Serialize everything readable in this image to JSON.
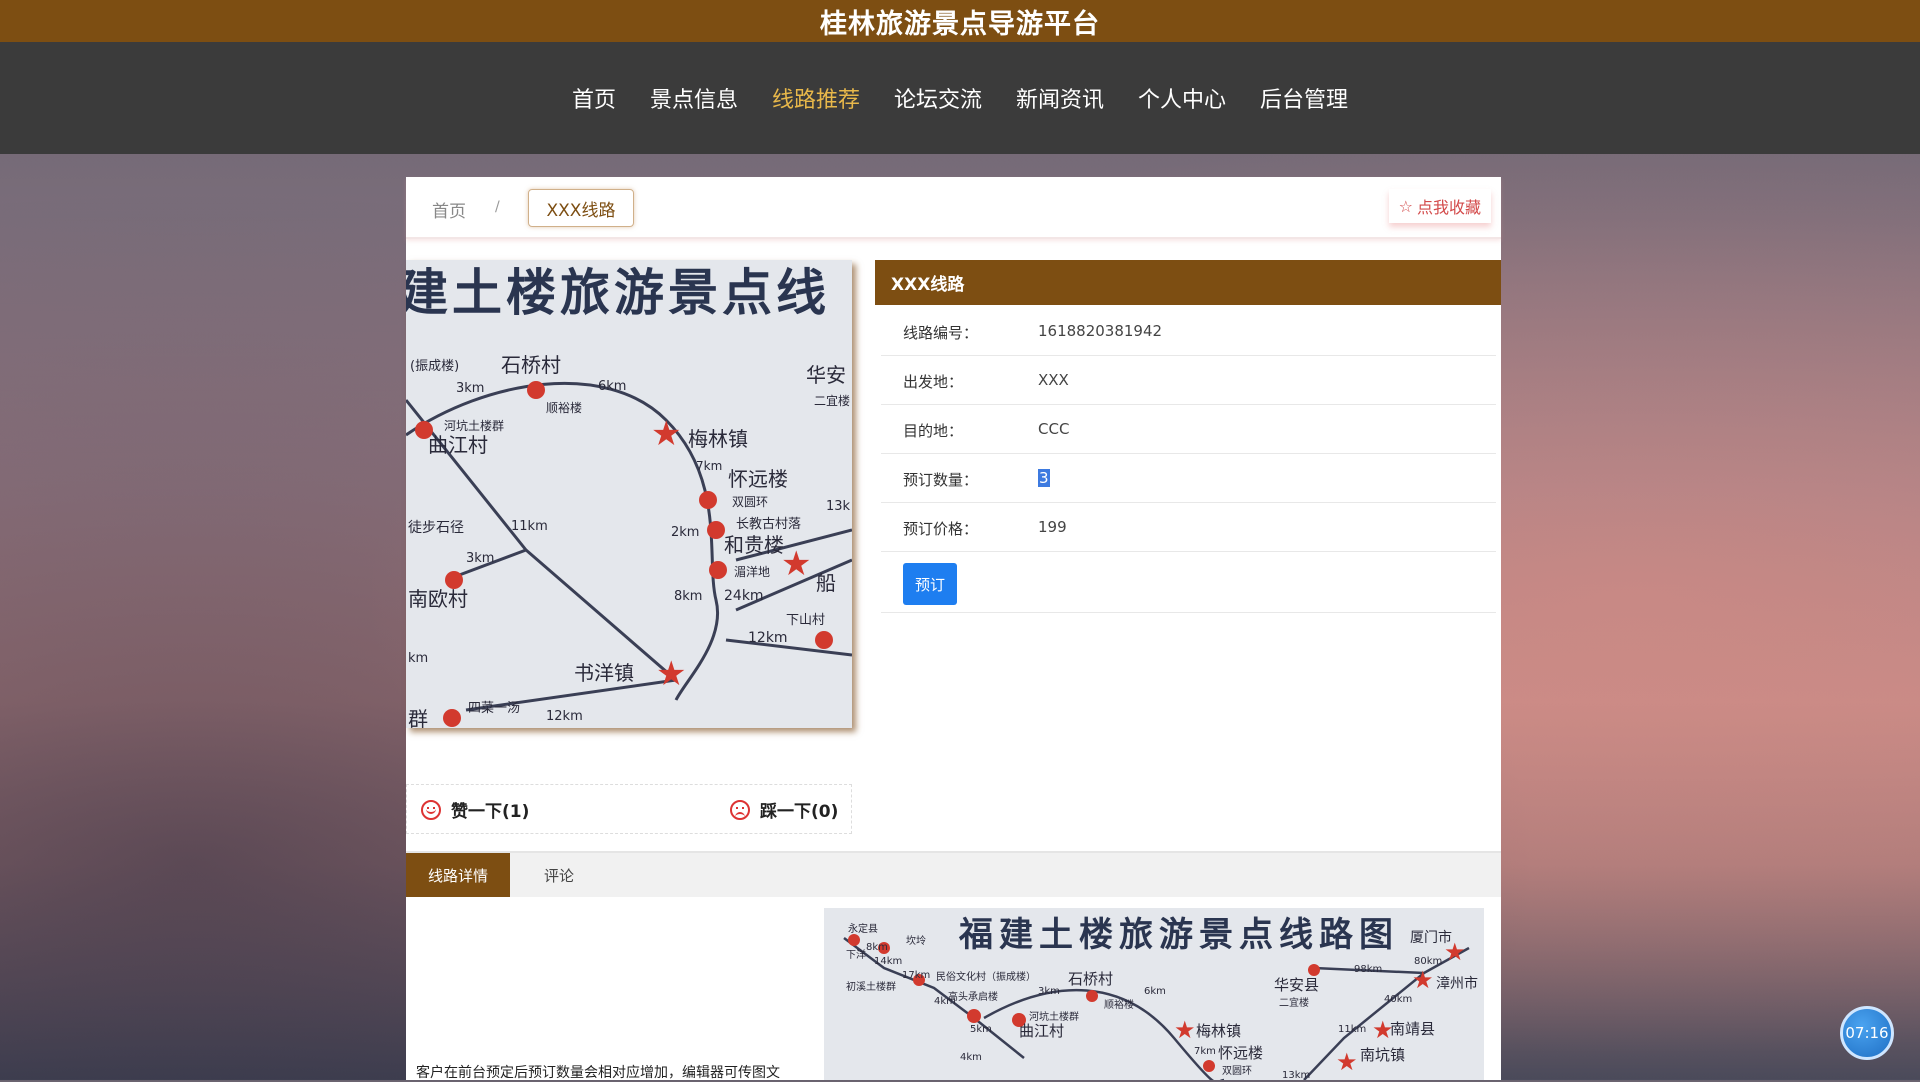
{
  "site_title": "桂林旅游景点导游平台",
  "nav": [
    "首页",
    "景点信息",
    "线路推荐",
    "论坛交流",
    "新闻资讯",
    "个人中心",
    "后台管理"
  ],
  "nav_active_index": 2,
  "breadcrumb": {
    "home": "首页",
    "sep": "/",
    "current": "XXX线路"
  },
  "favorite_label": "点我收藏",
  "route": {
    "title": "XXX线路",
    "fields": [
      {
        "label": "线路编号：",
        "value": "1618820381942"
      },
      {
        "label": "出发地：",
        "value": "XXX"
      },
      {
        "label": "目的地：",
        "value": "CCC"
      },
      {
        "label": "预订数量：",
        "value": "3"
      },
      {
        "label": "预订价格：",
        "value": "199"
      }
    ],
    "book_button": "预订"
  },
  "votes": {
    "like": "赞一下(1)",
    "dislike": "踩一下(0)"
  },
  "tabs": [
    "线路详情",
    "评论"
  ],
  "detail_text": "客户在前台预定后预订数量会相对应增加，编辑器可传图文",
  "image_main": {
    "title": "建土楼旅游景点线",
    "labels": [
      "(振成楼)",
      "石桥村",
      "6km",
      "华安",
      "二宜楼",
      "3km",
      "顺裕楼",
      "河坑土楼群",
      "曲江村",
      "梅林镇",
      "7km",
      "怀远楼",
      "双圆环",
      "长教古村落",
      "13k",
      "徒步石径",
      "11km",
      "2km",
      "和贵楼",
      "3km",
      "湄洋地",
      "南欧村",
      "8km",
      "24km",
      "船",
      "下山村",
      "12km",
      "km",
      "书洋镇",
      "群",
      "四菜一汤",
      "12km"
    ]
  },
  "image_detail": {
    "title": "福建土楼旅游景点线路图",
    "labels": [
      "永定县",
      "坎坽",
      "下洋",
      "8km",
      "14km",
      "17km",
      "初溪土楼群",
      "民俗文化村（振成楼）",
      "石桥村",
      "6km",
      "华安县",
      "二宜楼",
      "98km",
      "厦门市",
      "80km",
      "漳州市",
      "4km",
      "高头承启楼",
      "3km",
      "顺裕楼",
      "40km",
      "5km",
      "河坑土楼群",
      "曲江村",
      "梅林镇",
      "11km",
      "南靖县",
      "7km",
      "怀远楼",
      "双圆环",
      "南坑镇",
      "4km",
      "13km"
    ]
  },
  "clock": "07:16"
}
